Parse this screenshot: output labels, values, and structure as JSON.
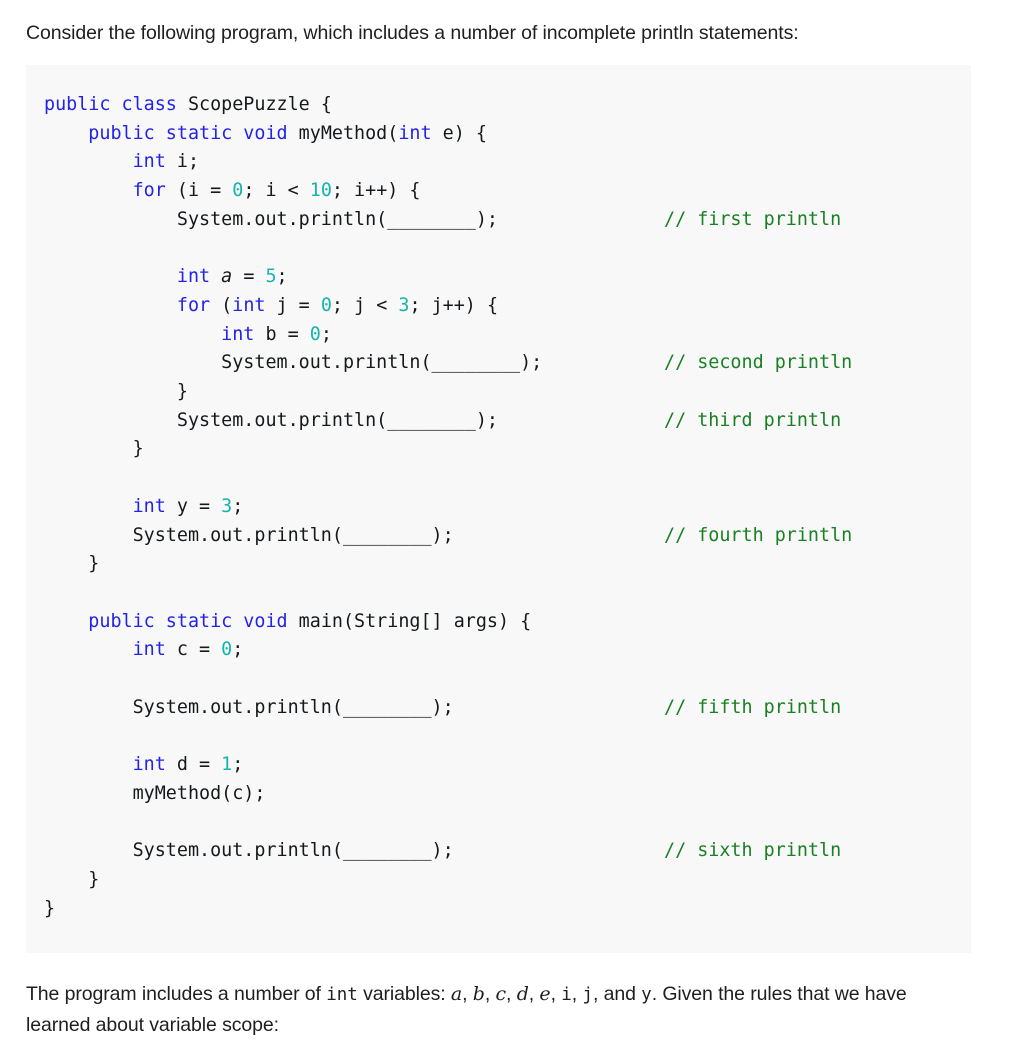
{
  "intro": {
    "text": "Consider the following program, which includes a number of incomplete println statements:"
  },
  "code_block": {
    "language": "java",
    "class_name": "ScopePuzzle",
    "blank_placeholder": "________",
    "colors": {
      "background": "#f8f8f8",
      "keyword": "#2323e6",
      "number": "#16b5ab",
      "comment": "#1a8024",
      "text": "#16191c"
    },
    "lines": [
      {
        "indent": 0,
        "tokens": [
          {
            "t": "kw",
            "v": "public class"
          },
          {
            "t": "plain",
            "v": " ScopePuzzle {"
          }
        ],
        "comment": ""
      },
      {
        "indent": 1,
        "tokens": [
          {
            "t": "kw",
            "v": "public static void"
          },
          {
            "t": "plain",
            "v": " myMethod("
          },
          {
            "t": "kw",
            "v": "int"
          },
          {
            "t": "plain",
            "v": " e) {"
          }
        ],
        "comment": ""
      },
      {
        "indent": 2,
        "tokens": [
          {
            "t": "kw",
            "v": "int"
          },
          {
            "t": "plain",
            "v": " i;"
          }
        ],
        "comment": ""
      },
      {
        "indent": 2,
        "tokens": [
          {
            "t": "kw",
            "v": "for"
          },
          {
            "t": "plain",
            "v": " (i = "
          },
          {
            "t": "num",
            "v": "0"
          },
          {
            "t": "plain",
            "v": "; i < "
          },
          {
            "t": "num",
            "v": "10"
          },
          {
            "t": "plain",
            "v": "; i++) {"
          }
        ],
        "comment": ""
      },
      {
        "indent": 3,
        "tokens": [
          {
            "t": "plain",
            "v": "System.out.println(________);"
          }
        ],
        "comment": "// first println"
      },
      {
        "indent": 0,
        "tokens": [],
        "comment": ""
      },
      {
        "indent": 3,
        "tokens": [
          {
            "t": "kw",
            "v": "int"
          },
          {
            "t": "ital",
            "v": " a"
          },
          {
            "t": "plain",
            "v": " = "
          },
          {
            "t": "num",
            "v": "5"
          },
          {
            "t": "plain",
            "v": ";"
          }
        ],
        "comment": ""
      },
      {
        "indent": 3,
        "tokens": [
          {
            "t": "kw",
            "v": "for"
          },
          {
            "t": "plain",
            "v": " ("
          },
          {
            "t": "kw",
            "v": "int"
          },
          {
            "t": "plain",
            "v": " j = "
          },
          {
            "t": "num",
            "v": "0"
          },
          {
            "t": "plain",
            "v": "; j < "
          },
          {
            "t": "num",
            "v": "3"
          },
          {
            "t": "plain",
            "v": "; j++) {"
          }
        ],
        "comment": ""
      },
      {
        "indent": 4,
        "tokens": [
          {
            "t": "kw",
            "v": "int"
          },
          {
            "t": "plain",
            "v": " b = "
          },
          {
            "t": "num",
            "v": "0"
          },
          {
            "t": "plain",
            "v": ";"
          }
        ],
        "comment": ""
      },
      {
        "indent": 4,
        "tokens": [
          {
            "t": "plain",
            "v": "System.out.println(________);"
          }
        ],
        "comment": "// second println"
      },
      {
        "indent": 3,
        "tokens": [
          {
            "t": "plain",
            "v": "}"
          }
        ],
        "comment": ""
      },
      {
        "indent": 3,
        "tokens": [
          {
            "t": "plain",
            "v": "System.out.println(________);"
          }
        ],
        "comment": "// third println"
      },
      {
        "indent": 2,
        "tokens": [
          {
            "t": "plain",
            "v": "}"
          }
        ],
        "comment": ""
      },
      {
        "indent": 0,
        "tokens": [],
        "comment": ""
      },
      {
        "indent": 2,
        "tokens": [
          {
            "t": "kw",
            "v": "int"
          },
          {
            "t": "plain",
            "v": " y = "
          },
          {
            "t": "num",
            "v": "3"
          },
          {
            "t": "plain",
            "v": ";"
          }
        ],
        "comment": ""
      },
      {
        "indent": 2,
        "tokens": [
          {
            "t": "plain",
            "v": "System.out.println(________);"
          }
        ],
        "comment": "// fourth println"
      },
      {
        "indent": 1,
        "tokens": [
          {
            "t": "plain",
            "v": "}"
          }
        ],
        "comment": ""
      },
      {
        "indent": 0,
        "tokens": [],
        "comment": ""
      },
      {
        "indent": 1,
        "tokens": [
          {
            "t": "kw",
            "v": "public static void"
          },
          {
            "t": "plain",
            "v": " main(String[] args) {"
          }
        ],
        "comment": ""
      },
      {
        "indent": 2,
        "tokens": [
          {
            "t": "kw",
            "v": "int"
          },
          {
            "t": "plain",
            "v": " c = "
          },
          {
            "t": "num",
            "v": "0"
          },
          {
            "t": "plain",
            "v": ";"
          }
        ],
        "comment": ""
      },
      {
        "indent": 0,
        "tokens": [],
        "comment": ""
      },
      {
        "indent": 2,
        "tokens": [
          {
            "t": "plain",
            "v": "System.out.println(________);"
          }
        ],
        "comment": "// fifth println"
      },
      {
        "indent": 0,
        "tokens": [],
        "comment": ""
      },
      {
        "indent": 2,
        "tokens": [
          {
            "t": "kw",
            "v": "int"
          },
          {
            "t": "plain",
            "v": " d = "
          },
          {
            "t": "num",
            "v": "1"
          },
          {
            "t": "plain",
            "v": ";"
          }
        ],
        "comment": ""
      },
      {
        "indent": 2,
        "tokens": [
          {
            "t": "plain",
            "v": "myMethod(c);"
          }
        ],
        "comment": ""
      },
      {
        "indent": 0,
        "tokens": [],
        "comment": ""
      },
      {
        "indent": 2,
        "tokens": [
          {
            "t": "plain",
            "v": "System.out.println(________);"
          }
        ],
        "comment": "// sixth println"
      },
      {
        "indent": 1,
        "tokens": [
          {
            "t": "plain",
            "v": "}"
          }
        ],
        "comment": ""
      },
      {
        "indent": 0,
        "tokens": [
          {
            "t": "plain",
            "v": "}"
          }
        ],
        "comment": ""
      }
    ],
    "comments": [
      "// first println",
      "// second println",
      "// third println",
      "// fourth println",
      "// fifth println",
      "// sixth println"
    ]
  },
  "closing": {
    "part1": "The program includes a number of ",
    "code_int": "int",
    "part2": " variables: ",
    "vars_italic": [
      "a",
      "b",
      "c",
      "d",
      "e"
    ],
    "vars_mono": [
      "i",
      "j"
    ],
    "conjunction": ", and ",
    "last_var": "y",
    "part3": ". Given the rules that we have learned about variable scope:",
    "full_text": "The program includes a number of int variables: a, b, c, d, e, i, j, and y. Given the rules that we have learned about variable scope:"
  }
}
